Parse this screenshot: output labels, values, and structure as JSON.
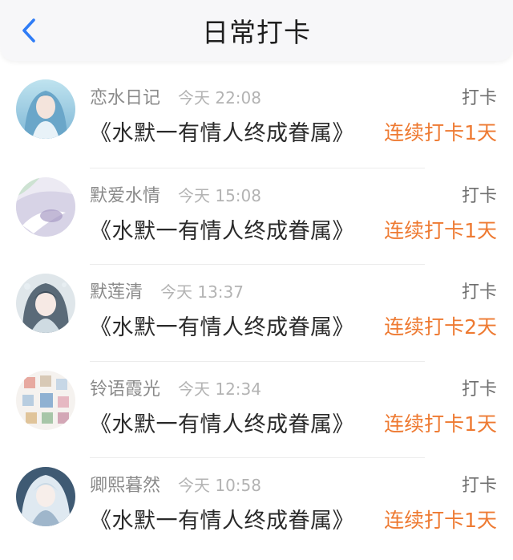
{
  "header": {
    "title": "日常打卡",
    "back_icon": "chevron-left-icon",
    "accent": "#2f7cf6"
  },
  "colors": {
    "streak": "#ee7a32",
    "name": "#8a8a8a",
    "time": "#b3b3b3"
  },
  "entries": [
    {
      "name": "恋水日记",
      "time": "今天 22:08",
      "action": "打卡",
      "book": "《水默一有情人终成眷属》",
      "streak": "连续打卡1天"
    },
    {
      "name": "默爱水情",
      "time": "今天 15:08",
      "action": "打卡",
      "book": "《水默一有情人终成眷属》",
      "streak": "连续打卡1天"
    },
    {
      "name": "默莲清",
      "time": "今天 13:37",
      "action": "打卡",
      "book": "《水默一有情人终成眷属》",
      "streak": "连续打卡2天"
    },
    {
      "name": "铃语霞光",
      "time": "今天 12:34",
      "action": "打卡",
      "book": "《水默一有情人终成眷属》",
      "streak": "连续打卡1天"
    },
    {
      "name": "卿熙暮然",
      "time": "今天 10:58",
      "action": "打卡",
      "book": "《水默一有情人终成眷属》",
      "streak": "连续打卡1天"
    }
  ]
}
